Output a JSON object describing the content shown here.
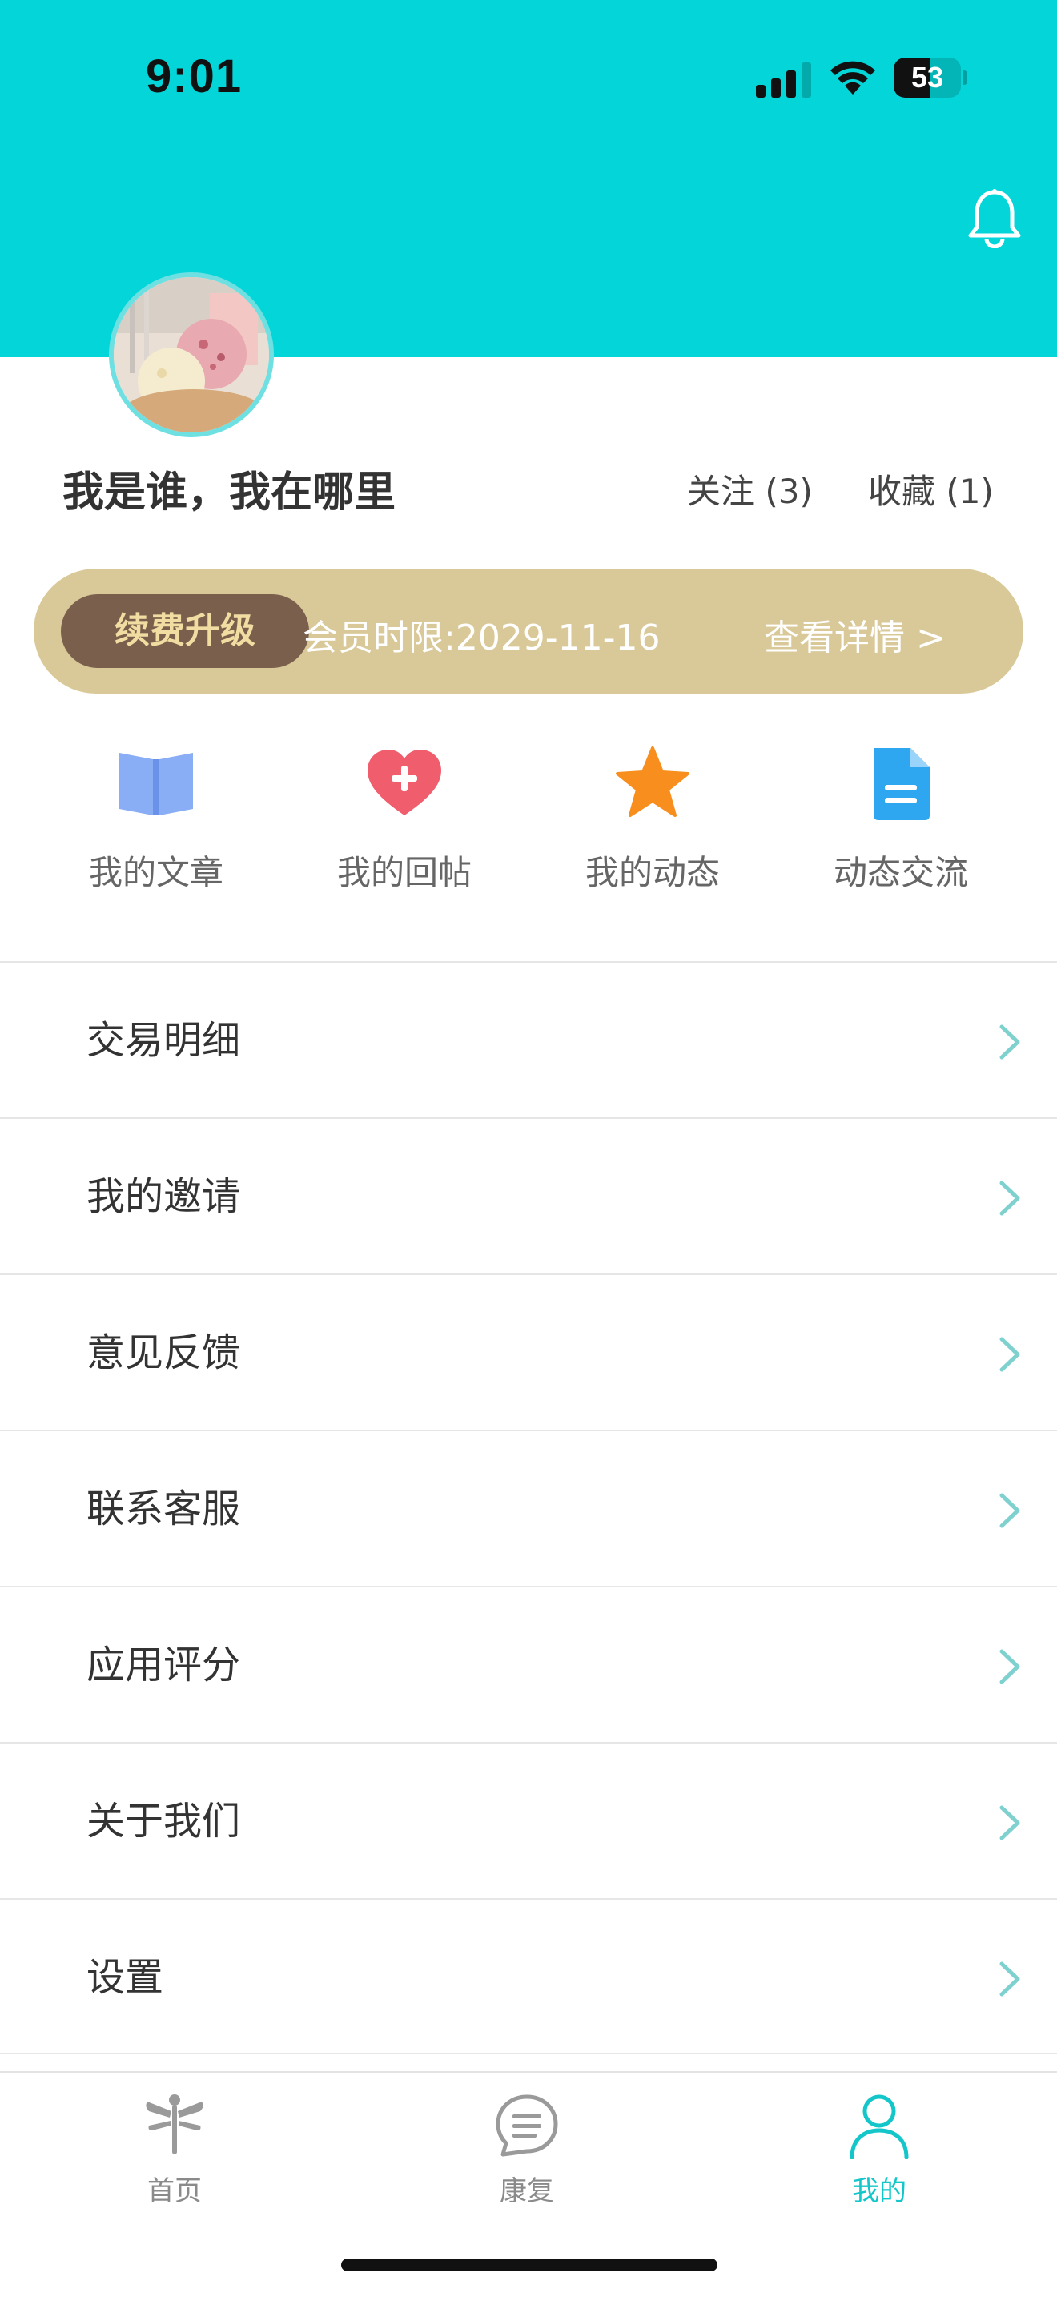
{
  "status_bar": {
    "time": "9:01",
    "battery": "53",
    "battery_level_percent": 53
  },
  "profile": {
    "name": "我是谁，我在哪里",
    "follow": "关注 (3)",
    "favorites": "收藏 (1)"
  },
  "membership": {
    "renew_label": "续费升级",
    "expiry": "会员时限:2029-11-16",
    "details": "查看详情 >"
  },
  "quick_actions": [
    {
      "label": "我的文章",
      "icon": "open-book-icon",
      "color": "#8aaef5"
    },
    {
      "label": "我的回帖",
      "icon": "heart-plus-icon",
      "color": "#f05d6c"
    },
    {
      "label": "我的动态",
      "icon": "star-icon",
      "color": "#f78e1e"
    },
    {
      "label": "动态交流",
      "icon": "document-icon",
      "color": "#2fa7f0"
    }
  ],
  "menu": [
    {
      "label": "交易明细"
    },
    {
      "label": "我的邀请"
    },
    {
      "label": "意见反馈"
    },
    {
      "label": "联系客服"
    },
    {
      "label": "应用评分"
    },
    {
      "label": "关于我们"
    },
    {
      "label": "设置"
    }
  ],
  "tabs": [
    {
      "label": "首页",
      "icon": "dragonfly-icon"
    },
    {
      "label": "康复",
      "icon": "chat-bubble-icon"
    },
    {
      "label": "我的",
      "icon": "person-icon",
      "active": true
    }
  ],
  "colors": {
    "header": "#04d5d8",
    "accent": "#13c6c9",
    "member_bar": "#d9c898",
    "renew_button": "#7a5f4c"
  }
}
